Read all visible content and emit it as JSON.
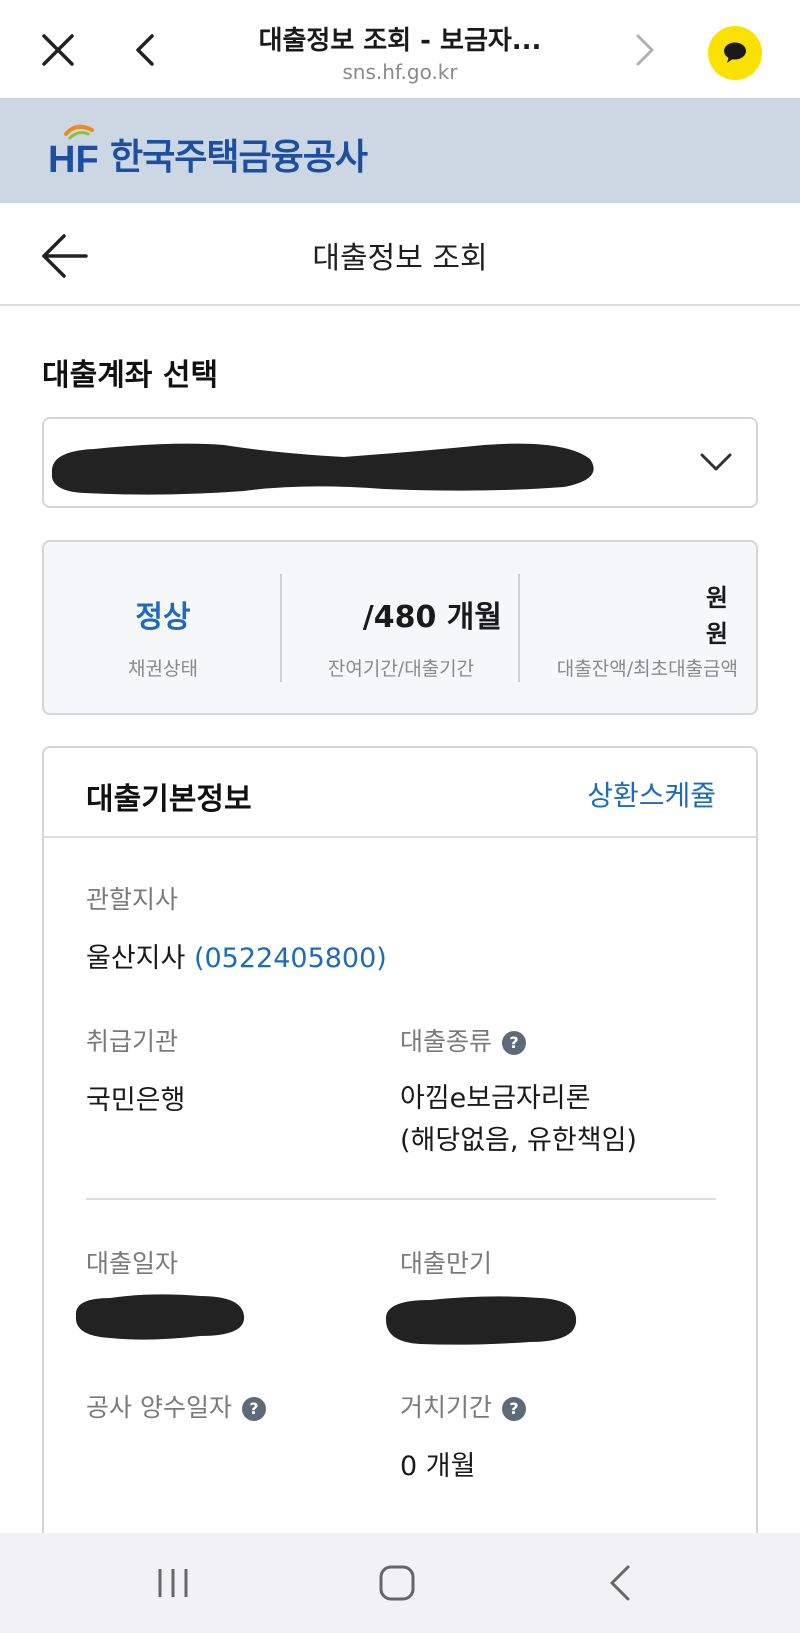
{
  "browser": {
    "title": "대출정보 조회 - 보금자...",
    "url": "sns.hf.go.kr",
    "icons": [
      "close-icon",
      "back-icon",
      "forward-icon",
      "kakaotalk-icon"
    ]
  },
  "brand": {
    "mark": "HF",
    "name": "한국주택금융공사",
    "brand_color": "#1c4fa0"
  },
  "page": {
    "title": "대출정보 조회"
  },
  "account": {
    "section_title": "대출계좌 선택"
  },
  "summary": {
    "status_value": "정상",
    "status_label": "채권상태",
    "period_value": "/480 개월",
    "period_label": "잔여기간/대출기간",
    "balance_line1": "원",
    "balance_line2": "원",
    "balance_label": "대출잔액/최초대출금액"
  },
  "basic_info": {
    "title": "대출기본정보",
    "schedule_link": "상환스케쥴",
    "branch_label": "관할지사",
    "branch_value": "울산지사",
    "branch_phone": "(0522405800)",
    "agency_label": "취급기관",
    "agency_value": "국민은행",
    "loan_type_label": "대출종류",
    "loan_type_line1": "아낌e보금자리론",
    "loan_type_line2": "(해당없음, 유한책임)",
    "loan_date_label": "대출일자",
    "maturity_label": "대출만기",
    "transfer_date_label": "공사 양수일자",
    "grace_label": "거치기간",
    "grace_value": "0 개월",
    "help_glyph": "?"
  },
  "colors": {
    "accent": "#1e6bb8",
    "header_bg": "#cdd7e4",
    "kakao": "#fae100"
  }
}
